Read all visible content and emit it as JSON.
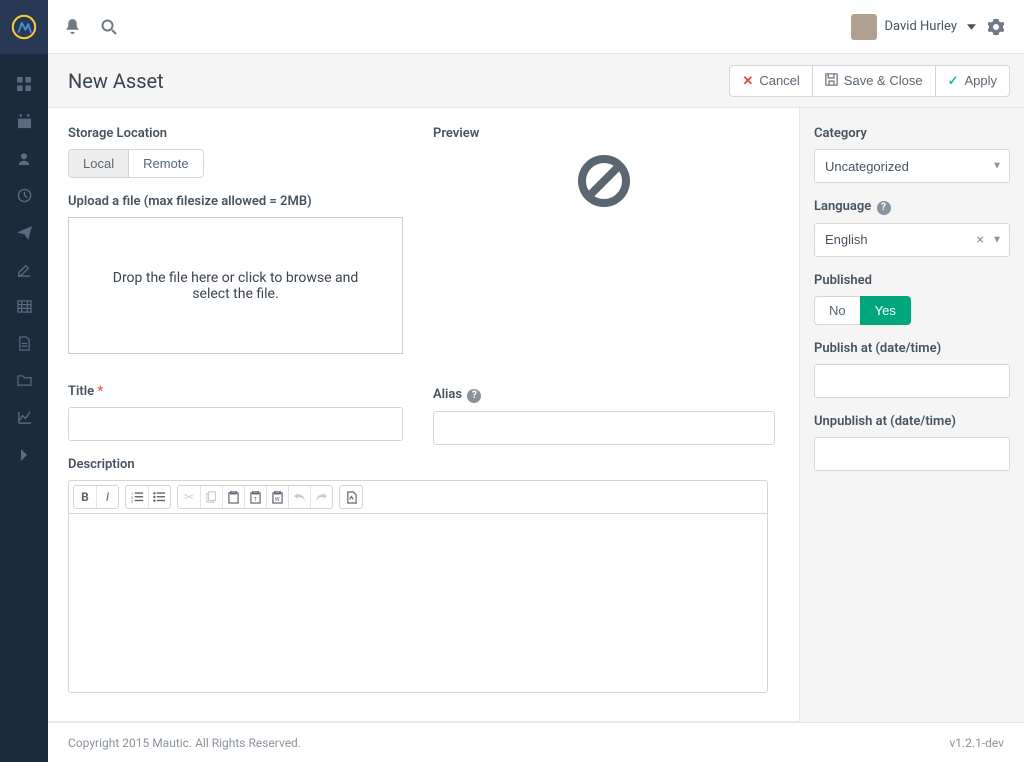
{
  "header": {
    "user_name": "David Hurley"
  },
  "page": {
    "title": "New Asset"
  },
  "actions": {
    "cancel": "Cancel",
    "save_close": "Save & Close",
    "apply": "Apply"
  },
  "form_left": {
    "storage_location_label": "Storage Location",
    "storage_local": "Local",
    "storage_remote": "Remote",
    "upload_label": "Upload a file (max filesize allowed = 2MB)",
    "dropzone_text": "Drop the file here or click to browse and select the file.",
    "title_label": "Title",
    "description_label": "Description"
  },
  "form_mid": {
    "preview_label": "Preview",
    "alias_label": "Alias"
  },
  "right": {
    "category_label": "Category",
    "category_value": "Uncategorized",
    "language_label": "Language",
    "language_value": "English",
    "published_label": "Published",
    "published_no": "No",
    "published_yes": "Yes",
    "publish_at_label": "Publish at (date/time)",
    "unpublish_at_label": "Unpublish at (date/time)"
  },
  "footer": {
    "copyright": "Copyright 2015 Mautic. All Rights Reserved.",
    "version": "v1.2.1-dev"
  }
}
